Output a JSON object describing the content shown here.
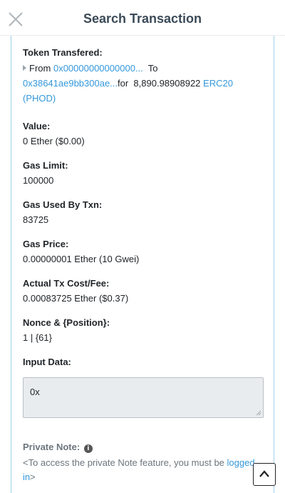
{
  "header": {
    "title": "Search Transaction"
  },
  "token_transfer": {
    "label": "Token Transfered:",
    "from_text": "From",
    "from_address": "0x00000000000000...",
    "to_text": "To",
    "to_address": "0x38641ae9bb300ae...",
    "for_text": "for",
    "amount": "8,890.98908922",
    "token": "ERC20",
    "token_symbol": "(PHOD)"
  },
  "fields": {
    "value": {
      "label": "Value:",
      "value": "0 Ether ($0.00)"
    },
    "gas_limit": {
      "label": "Gas Limit:",
      "value": "100000"
    },
    "gas_used": {
      "label": "Gas Used By Txn:",
      "value": "83725"
    },
    "gas_price": {
      "label": "Gas Price:",
      "value": "0.00000001 Ether (10 Gwei)"
    },
    "tx_fee": {
      "label": "Actual Tx Cost/Fee:",
      "value": "0.00083725 Ether ($0.37)"
    },
    "nonce": {
      "label": "Nonce & {Position}:",
      "value": "1 | {61}"
    },
    "input": {
      "label": "Input Data:",
      "value": "0x"
    }
  },
  "private_note": {
    "label": "Private Note:",
    "text_before": "<To access the private Note feature, you must be",
    "link_text": "logged in",
    "text_after": ">"
  },
  "icons": {
    "close": "close-icon",
    "caret": "caret-right-icon",
    "info": "info-circle-icon",
    "scroll_top": "chevron-up-icon"
  },
  "colors": {
    "link": "#3498db",
    "panel_border": "#9fd1e8",
    "title": "#3b4a57"
  }
}
